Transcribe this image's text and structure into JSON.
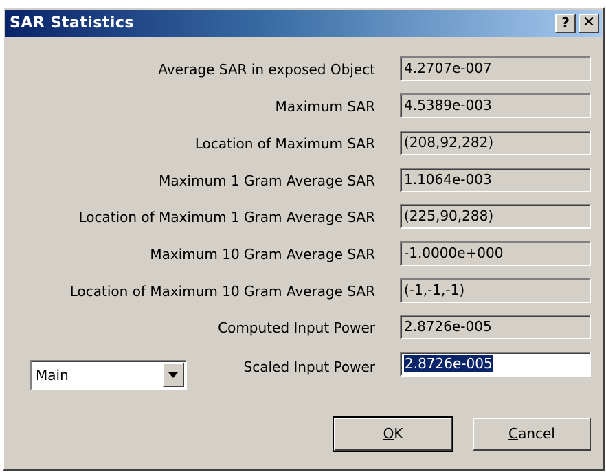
{
  "window": {
    "title": "SAR Statistics",
    "help_glyph": "?",
    "close_glyph": "✕"
  },
  "rows": [
    {
      "label": "Average SAR in exposed Object",
      "value": "4.2707e-007"
    },
    {
      "label": "Maximum SAR",
      "value": "4.5389e-003"
    },
    {
      "label": "Location of Maximum SAR",
      "value": "(208,92,282)"
    },
    {
      "label": "Maximum 1 Gram Average SAR",
      "value": "1.1064e-003"
    },
    {
      "label": "Location of Maximum 1 Gram Average SAR",
      "value": "(225,90,288)"
    },
    {
      "label": "Maximum 10 Gram Average SAR",
      "value": "-1.0000e+000"
    },
    {
      "label": "Location of Maximum 10 Gram Average SAR",
      "value": "(-1,-1,-1)"
    },
    {
      "label": "Computed Input Power",
      "value": "2.8726e-005"
    },
    {
      "label": "Scaled Input Power",
      "value": "2.8726e-005"
    }
  ],
  "combo": {
    "selected": "Main"
  },
  "buttons": {
    "ok_accel": "O",
    "ok_rest": "K",
    "cancel_accel": "C",
    "cancel_rest": "ancel"
  },
  "icons": {
    "combo_arrow": "triangle-down-icon",
    "help": "help-icon",
    "close": "close-icon"
  },
  "colors": {
    "title_start": "#0a246a",
    "title_end": "#a6caf0",
    "face": "#d4d0c8",
    "selection": "#0a246a"
  }
}
